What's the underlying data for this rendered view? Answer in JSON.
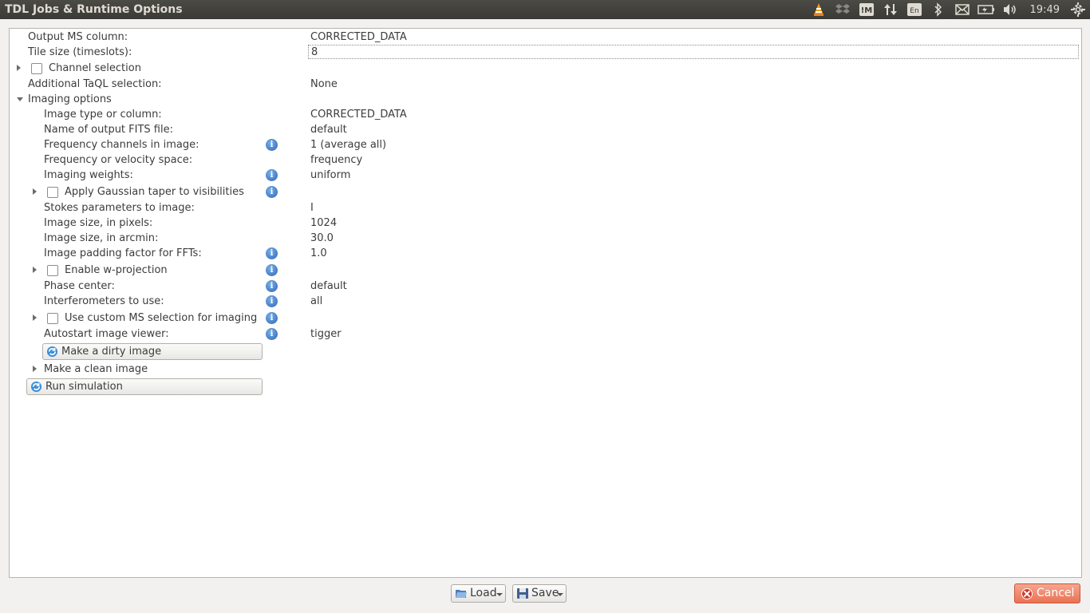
{
  "window": {
    "title": "TDL Jobs & Runtime Options"
  },
  "tray": {
    "clock": "19:49",
    "keyboard_layout": "En"
  },
  "form": {
    "output_ms_column": {
      "label": "Output MS column:",
      "value": "CORRECTED_DATA"
    },
    "tile_size": {
      "label": "Tile size (timeslots):",
      "value": "8"
    },
    "channel_selection": {
      "label": "Channel selection",
      "checked": false
    },
    "taql_selection": {
      "label": "Additional TaQL selection:",
      "value": "None"
    },
    "imaging_options": {
      "label": "Imaging options",
      "image_type": {
        "label": "Image type or column:",
        "value": "CORRECTED_DATA"
      },
      "fits_name": {
        "label": "Name of output FITS file:",
        "value": "default"
      },
      "freq_channels": {
        "label": "Frequency channels in image:",
        "value": "1 (average all)"
      },
      "freq_velocity": {
        "label": "Frequency or velocity space:",
        "value": "frequency"
      },
      "weights": {
        "label": "Imaging weights:",
        "value": "uniform"
      },
      "gaussian_taper": {
        "label": "Apply Gaussian taper to visibilities",
        "checked": false
      },
      "stokes": {
        "label": "Stokes parameters to image:",
        "value": "I"
      },
      "size_pixels": {
        "label": "Image size, in pixels:",
        "value": "1024"
      },
      "size_arcmin": {
        "label": "Image size, in arcmin:",
        "value": "30.0"
      },
      "padding": {
        "label": "Image padding factor for FFTs:",
        "value": "1.0"
      },
      "w_projection": {
        "label": "Enable w-projection",
        "checked": false
      },
      "phase_center": {
        "label": "Phase center:",
        "value": "default"
      },
      "interferometers": {
        "label": "Interferometers to use:",
        "value": "all"
      },
      "custom_ms": {
        "label": "Use custom MS selection for imaging",
        "checked": false
      },
      "autostart_viewer": {
        "label": "Autostart image viewer:",
        "value": "tigger"
      },
      "dirty_image_button": "Make a dirty image",
      "clean_image": {
        "label": "Make a clean image"
      }
    },
    "run_simulation_button": "Run simulation"
  },
  "buttons": {
    "load": "Load",
    "save": "Save",
    "cancel": "Cancel"
  }
}
